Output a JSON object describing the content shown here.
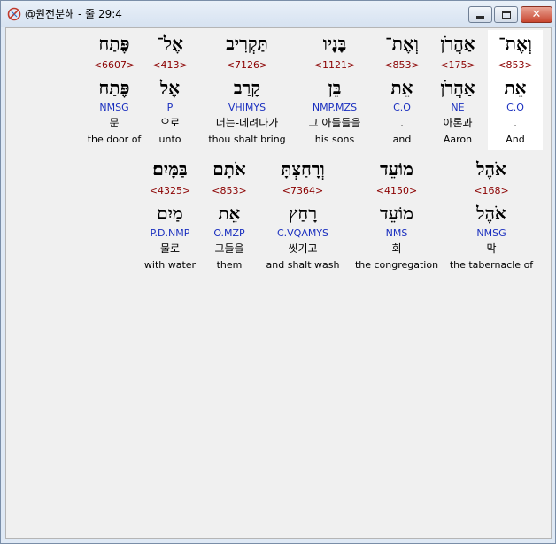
{
  "window": {
    "title": "@원전분해 - 줄 29:4",
    "close_glyph": "✕"
  },
  "rows": [
    [
      {
        "heb": "וְאֶת־",
        "strong": "<853>",
        "lemma": "אֵת",
        "morph": "C.O",
        "kor": ".",
        "eng": "And",
        "selected": true
      },
      {
        "heb": "אַהֲרֹן",
        "strong": "<175>",
        "lemma": "אַהֲרֹן",
        "morph": "NE",
        "kor": "아론과",
        "eng": "Aaron"
      },
      {
        "heb": "וְאֶת־",
        "strong": "<853>",
        "lemma": "אֵת",
        "morph": "C.O",
        "kor": ".",
        "eng": "and"
      },
      {
        "heb": "בָּנָיו",
        "strong": "<1121>",
        "lemma": "בֵּן",
        "morph": "NMP.MZS",
        "kor": "그 아들들을",
        "eng": "his sons"
      },
      {
        "heb": "תַּקְרִיב",
        "strong": "<7126>",
        "lemma": "קָרַב",
        "morph": "VHIMYS",
        "kor": "너는-데려다가",
        "eng": "thou shalt bring"
      },
      {
        "heb": "אֶל־",
        "strong": "<413>",
        "lemma": "אֶל",
        "morph": "P",
        "kor": "으로",
        "eng": "unto"
      },
      {
        "heb": "פֶּתַח",
        "strong": "<6607>",
        "lemma": "פֶּתַח",
        "morph": "NMSG",
        "kor": "문",
        "eng": "the door of"
      }
    ],
    [
      {
        "heb": "אֹהֶל",
        "strong": "<168>",
        "lemma": "אֹהֶל",
        "morph": "NMSG",
        "kor": "막",
        "eng": "the tabernacle of"
      },
      {
        "heb": "מוֹעֵד",
        "strong": "<4150>",
        "lemma": "מוֹעֵד",
        "morph": "NMS",
        "kor": "회",
        "eng": "the congregation"
      },
      {
        "heb": "וְרָחַצְתָּ",
        "strong": "<7364>",
        "lemma": "רָחַץ",
        "morph": "C.VQAMYS",
        "kor": "씻기고",
        "eng": "and shalt wash"
      },
      {
        "heb": "אֹתָם",
        "strong": "<853>",
        "lemma": "אֵת",
        "morph": "O.MZP",
        "kor": "그들을",
        "eng": "them"
      },
      {
        "heb": "בַּמָּיִם׃",
        "strong": "<4325>",
        "lemma": "מַיִם",
        "morph": "P.D.NMP",
        "kor": "물로",
        "eng": "with water"
      }
    ]
  ]
}
